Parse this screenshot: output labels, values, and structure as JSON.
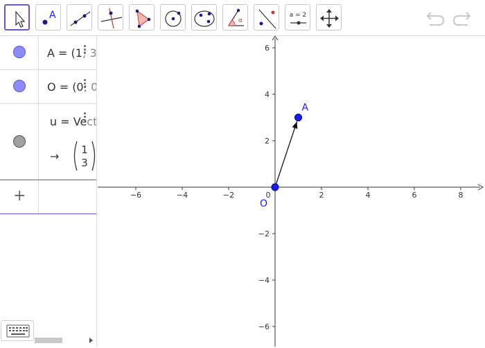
{
  "toolbar": {
    "tools": [
      {
        "icon": "move-arrow-icon",
        "selected": true
      },
      {
        "icon": "point-icon",
        "label": "A"
      },
      {
        "icon": "line-icon"
      },
      {
        "icon": "perpendicular-line-icon"
      },
      {
        "icon": "polygon-icon"
      },
      {
        "icon": "circle-center-point-icon"
      },
      {
        "icon": "conic-ellipse-icon"
      },
      {
        "icon": "angle-icon",
        "label": "α"
      },
      {
        "icon": "reflect-icon"
      },
      {
        "icon": "slider-icon",
        "label": "a = 2"
      },
      {
        "icon": "move-graphics-view-icon"
      }
    ],
    "undo_icon": "undo-icon",
    "redo_icon": "redo-icon"
  },
  "algebra": {
    "rows": [
      {
        "name": "A",
        "eq": "=",
        "value_start": "(1",
        "value_rest": "; 3",
        "color": "#8c8cff"
      },
      {
        "name": "O",
        "eq": "=",
        "value_start": "(0",
        "value_rest": "; 0",
        "color": "#8c8cff"
      },
      {
        "name": "u",
        "eq": "=",
        "definition": "Ve",
        "definition_faded": "ctor",
        "arrow": "→",
        "vector_x": "1",
        "vector_y": "3",
        "color": "#999999"
      }
    ],
    "add_label": "+"
  },
  "graphics": {
    "x_ticks": [
      "−6",
      "−4",
      "−2",
      "0",
      "2",
      "4",
      "6",
      "8"
    ],
    "y_ticks": [
      "6",
      "4",
      "2",
      "−2",
      "−4",
      "−6"
    ],
    "origin_label": "O",
    "point_label": "A",
    "point_A": {
      "x": 1,
      "y": 3
    },
    "point_O": {
      "x": 0,
      "y": 0
    },
    "point_color": "#1a1aff"
  }
}
